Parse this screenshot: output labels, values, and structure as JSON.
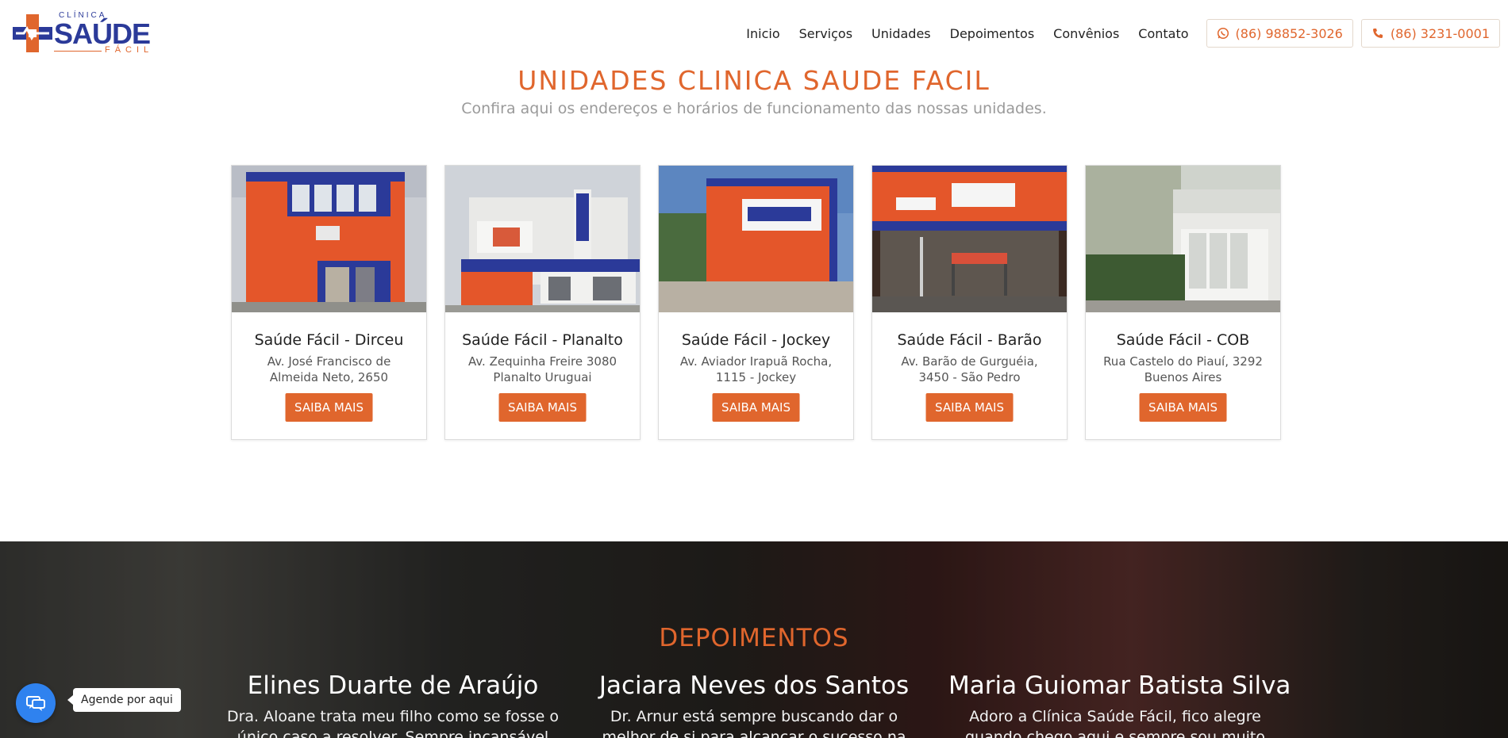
{
  "header": {
    "logo": {
      "clinica": "CLÍNICA",
      "saude": "SAÚDE",
      "facil": "FÁCIL"
    },
    "nav": [
      "Inicio",
      "Serviços",
      "Unidades",
      "Depoimentos",
      "Convênios",
      "Contato"
    ],
    "phones": [
      {
        "icon": "whatsapp-icon",
        "label": "(86) 98852-3026"
      },
      {
        "icon": "phone-icon",
        "label": "(86) 3231-0001"
      }
    ]
  },
  "units": {
    "title": "UNIDADES CLINICA SAUDE FACIL",
    "subtitle": "Confira aqui os endereços e horários de funcionamento das nossas unidades.",
    "cards": [
      {
        "name": "Saúde Fácil - Dirceu",
        "address": "Av. José Francisco de Almeida Neto, 2650",
        "button": "SAIBA MAIS"
      },
      {
        "name": "Saúde Fácil - Planalto",
        "address": "Av. Zequinha Freire 3080 Planalto Uruguai",
        "button": "SAIBA MAIS"
      },
      {
        "name": "Saúde Fácil - Jockey",
        "address": "Av. Aviador Irapuã Rocha, 1115 - Jockey",
        "button": "SAIBA MAIS"
      },
      {
        "name": "Saúde Fácil - Barão",
        "address": "Av. Barão de Gurguéia, 3450 - São Pedro",
        "button": "SAIBA MAIS"
      },
      {
        "name": "Saúde Fácil - COB",
        "address": "Rua Castelo do Piauí, 3292 Buenos Aires",
        "button": "SAIBA MAIS"
      }
    ]
  },
  "testimonials": {
    "title": "DEPOIMENTOS",
    "items": [
      {
        "name": "Elines Duarte de Araújo",
        "text": "Dra. Aloane trata meu filho como se fosse o único caso a resolver. Sempre incansável na"
      },
      {
        "name": "Jaciara Neves dos Santos",
        "text": "Dr. Arnur está sempre buscando dar o melhor de si para alcançar o sucesso na recuperação e"
      },
      {
        "name": "Maria Guiomar Batista Silva",
        "text": "Adoro a Clínica Saúde Fácil, fico alegre quando chego aqui e sempre sou muito bem atendida"
      }
    ]
  },
  "chat": {
    "icon": "chat-icon",
    "label": "Agende por aqui"
  },
  "colors": {
    "accent": "#e0662d",
    "brand_blue": "#2b3a99",
    "chat_blue": "#2f82ef"
  }
}
